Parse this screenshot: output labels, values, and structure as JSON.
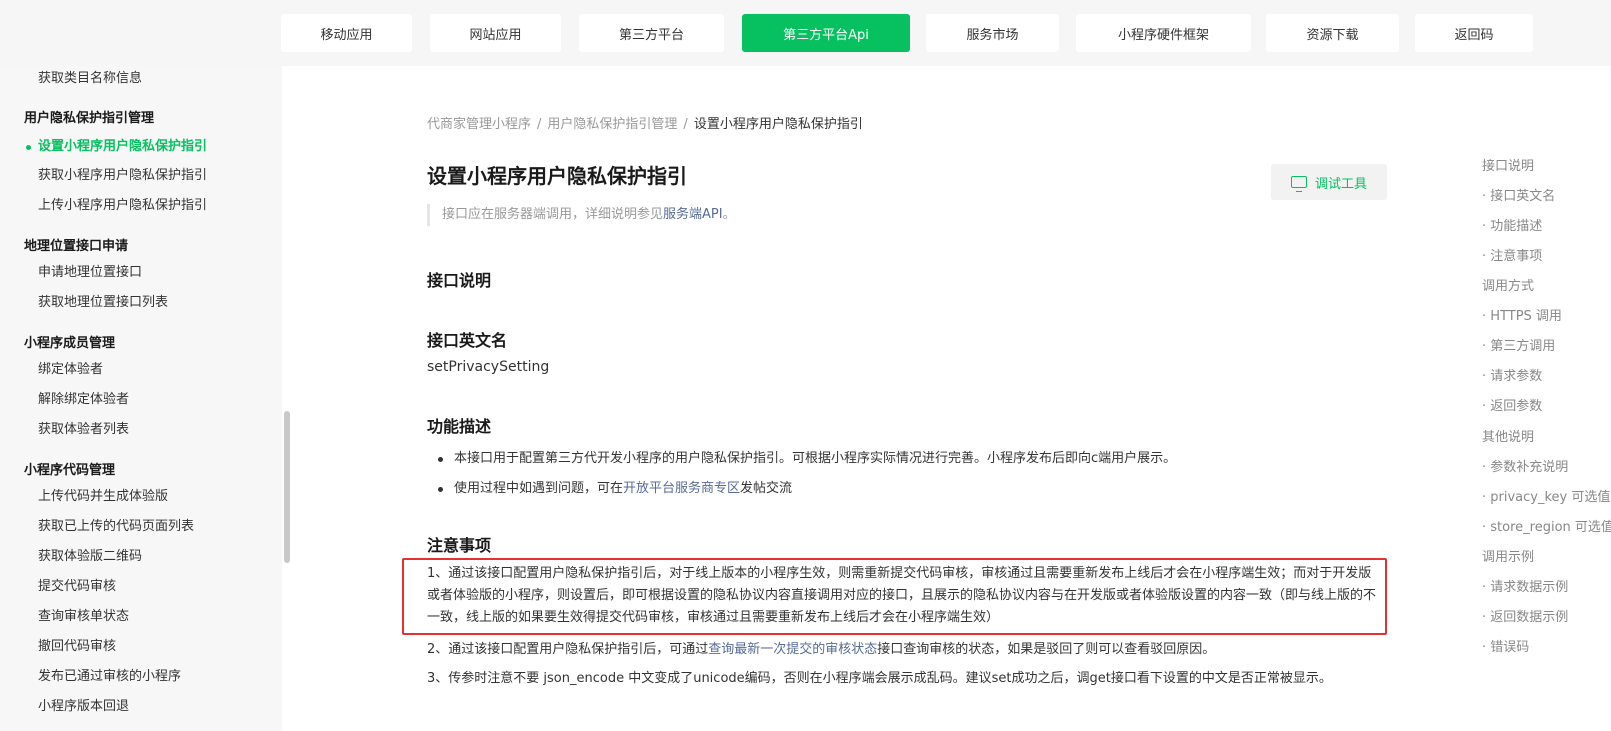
{
  "nav": {
    "tabs": [
      {
        "label": "移动应用",
        "active": false
      },
      {
        "label": "网站应用",
        "active": false
      },
      {
        "label": "第三方平台",
        "active": false
      },
      {
        "label": "第三方平台Api",
        "active": true
      },
      {
        "label": "服务市场",
        "active": false
      },
      {
        "label": "小程序硬件框架",
        "active": false
      },
      {
        "label": "资源下载",
        "active": false
      },
      {
        "label": "返回码",
        "active": false
      }
    ]
  },
  "sidebar": {
    "items": [
      {
        "type": "item",
        "label": "获取类目名称信息"
      },
      {
        "type": "group",
        "label": "用户隐私保护指引管理"
      },
      {
        "type": "item",
        "label": "设置小程序用户隐私保护指引",
        "active": true
      },
      {
        "type": "item",
        "label": "获取小程序用户隐私保护指引"
      },
      {
        "type": "item",
        "label": "上传小程序用户隐私保护指引"
      },
      {
        "type": "group",
        "label": "地理位置接口申请"
      },
      {
        "type": "item",
        "label": "申请地理位置接口"
      },
      {
        "type": "item",
        "label": "获取地理位置接口列表"
      },
      {
        "type": "group",
        "label": "小程序成员管理"
      },
      {
        "type": "item",
        "label": "绑定体验者"
      },
      {
        "type": "item",
        "label": "解除绑定体验者"
      },
      {
        "type": "item",
        "label": "获取体验者列表"
      },
      {
        "type": "group",
        "label": "小程序代码管理"
      },
      {
        "type": "item",
        "label": "上传代码并生成体验版"
      },
      {
        "type": "item",
        "label": "获取已上传的代码页面列表"
      },
      {
        "type": "item",
        "label": "获取体验版二维码"
      },
      {
        "type": "item",
        "label": "提交代码审核"
      },
      {
        "type": "item",
        "label": "查询审核单状态"
      },
      {
        "type": "item",
        "label": "撤回代码审核"
      },
      {
        "type": "item",
        "label": "发布已通过审核的小程序"
      },
      {
        "type": "item",
        "label": "小程序版本回退"
      }
    ]
  },
  "breadcrumb": {
    "items": [
      "代商家管理小程序",
      "用户隐私保护指引管理"
    ],
    "current": "设置小程序用户隐私保护指引",
    "separator": "/"
  },
  "main": {
    "title": "设置小程序用户隐私保护指引",
    "debug_button": "调试工具",
    "note_prefix": "接口应在服务器端调用，详细说明参见",
    "note_link": "服务端API",
    "note_suffix": "。",
    "section_api_desc": "接口说明",
    "section_en_name": "接口英文名",
    "en_name": "setPrivacySetting",
    "section_func": "功能描述",
    "func_bullet1": "本接口用于配置第三方代开发小程序的用户隐私保护指引。可根据小程序实际情况进行完善。小程序发布后即向c端用户展示。",
    "func_bullet2_prefix": "使用过程中如遇到问题，可在",
    "func_bullet2_link": "开放平台服务商专区",
    "func_bullet2_suffix": "发帖交流",
    "section_notes": "注意事项",
    "note1": "1、通过该接口配置用户隐私保护指引后，对于线上版本的小程序生效，则需重新提交代码审核，审核通过且需要重新发布上线后才会在小程序端生效；而对于开发版或者体验版的小程序，则设置后，即可根据设置的隐私协议内容直接调用对应的接口，且展示的隐私协议内容与在开发版或者体验版设置的内容一致（即与线上版的不一致，线上版的如果要生效得提交代码审核，审核通过且需要重新发布上线后才会在小程序端生效）",
    "note2_prefix": "2、通过该接口配置用户隐私保护指引后，可通过",
    "note2_link": "查询最新一次提交的审核状态",
    "note2_suffix": "接口查询审核的状态，如果是驳回了则可以查看驳回原因。",
    "note3": "3、传参时注意不要 json_encode 中文变成了unicode编码，否则在小程序端会展示成乱码。建议set成功之后，调get接口看下设置的中文是否正常被显示。"
  },
  "toc": {
    "items": [
      {
        "label": "接口说明",
        "level": 1
      },
      {
        "label": "· 接口英文名",
        "level": 2
      },
      {
        "label": "· 功能描述",
        "level": 2
      },
      {
        "label": "· 注意事项",
        "level": 2
      },
      {
        "label": "调用方式",
        "level": 1
      },
      {
        "label": "· HTTPS 调用",
        "level": 2
      },
      {
        "label": "· 第三方调用",
        "level": 2
      },
      {
        "label": "· 请求参数",
        "level": 2
      },
      {
        "label": "· 返回参数",
        "level": 2
      },
      {
        "label": "其他说明",
        "level": 1
      },
      {
        "label": "· 参数补充说明",
        "level": 2
      },
      {
        "label": "· privacy_key 可选值",
        "level": 2
      },
      {
        "label": "· store_region 可选值",
        "level": 2
      },
      {
        "label": "调用示例",
        "level": 1
      },
      {
        "label": "· 请求数据示例",
        "level": 2
      },
      {
        "label": "· 返回数据示例",
        "level": 2
      },
      {
        "label": "· 错误码",
        "level": 2
      }
    ]
  },
  "colors": {
    "accent": "#07c160",
    "link": "#576b95",
    "highlight_border": "#e83030"
  }
}
